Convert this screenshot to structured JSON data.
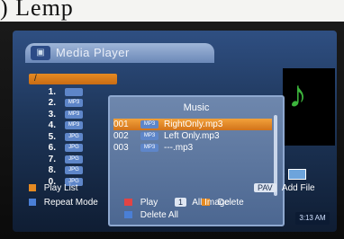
{
  "app": {
    "title": "Media Player"
  },
  "colors": {
    "accent": "#e58a22",
    "panel": "#5e86c9",
    "play": "#e24444",
    "delete": "#e58a22"
  },
  "filelist": {
    "path": "/",
    "rows": [
      {
        "num": "1.",
        "type": ""
      },
      {
        "num": "2.",
        "type": "MP3"
      },
      {
        "num": "3.",
        "type": "MP3"
      },
      {
        "num": "4.",
        "type": "MP3"
      },
      {
        "num": "5.",
        "type": "JPG"
      },
      {
        "num": "6.",
        "type": "JPG"
      },
      {
        "num": "7.",
        "type": "JPG"
      },
      {
        "num": "8.",
        "type": "JPG"
      },
      {
        "num": "0.",
        "type": "JPG"
      }
    ]
  },
  "dialog": {
    "title": "Music",
    "items": [
      {
        "num": "001",
        "type": "MP3",
        "name": "RightOnly.mp3",
        "selected": true
      },
      {
        "num": "002",
        "type": "MP3",
        "name": "Left Only.mp3",
        "selected": false
      },
      {
        "num": "003",
        "type": "MP3",
        "name": "---.mp3",
        "selected": false
      }
    ],
    "legend": {
      "play": "Play",
      "delete": "Delete",
      "delete_all": "Delete All"
    }
  },
  "bottom": {
    "play_list": "Play List",
    "add_file_key": "PAV",
    "add_file": "Add File",
    "repeat_mode": "Repeat Mode",
    "all_image_key": "1",
    "all_image": "All Image",
    "clock": "3:13 AM"
  }
}
